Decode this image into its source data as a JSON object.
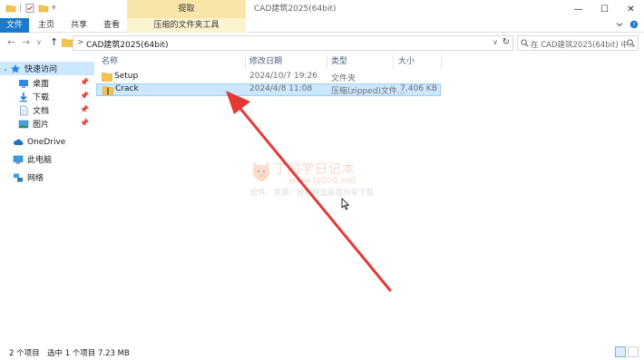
{
  "titlebar": {
    "context_tab": "提取",
    "title": "CAD建筑2025(64bit)"
  },
  "ribbon": {
    "tabs": [
      "文件",
      "主页",
      "共享",
      "查看"
    ],
    "context_tab": "压缩的文件夹工具"
  },
  "address": {
    "path_sep": ">",
    "path": "CAD建筑2025(64bit)",
    "search_placeholder": "在 CAD建筑2025(64bit) 中..."
  },
  "sidebar": {
    "quick_access": "快速访问",
    "items": [
      {
        "label": "桌面",
        "icon": "desktop-icon",
        "pinned": true
      },
      {
        "label": "下载",
        "icon": "download-icon",
        "pinned": true
      },
      {
        "label": "文档",
        "icon": "document-icon",
        "pinned": true
      },
      {
        "label": "图片",
        "icon": "picture-icon",
        "pinned": true
      }
    ],
    "onedrive": "OneDrive",
    "this_pc": "此电脑",
    "network": "网络"
  },
  "columns": {
    "name": "名称",
    "modified": "修改日期",
    "type": "类型",
    "size": "大小"
  },
  "files": [
    {
      "name": "Setup",
      "modified": "2024/10/7 19:26",
      "type": "文件夹",
      "size": "",
      "icon": "folder-icon",
      "selected": false
    },
    {
      "name": "Crack",
      "modified": "2024/4/8 11:08",
      "type": "压缩(zipped)文件...",
      "size": "7,406 KB",
      "icon": "zip-folder-icon",
      "selected": true
    }
  ],
  "watermark": {
    "title": "丁同学日记本",
    "url": "www.ts006.net",
    "subtitle": "软件、资源、技巧网盘直接分享下载"
  },
  "status": {
    "count": "2 个项目",
    "selection": "选中 1 个项目  7.23 MB"
  },
  "colors": {
    "file_tab": "#1979ca",
    "context_tab": "#f7e6a8",
    "selection": "#cce8ff",
    "arrow": "#e53935"
  }
}
